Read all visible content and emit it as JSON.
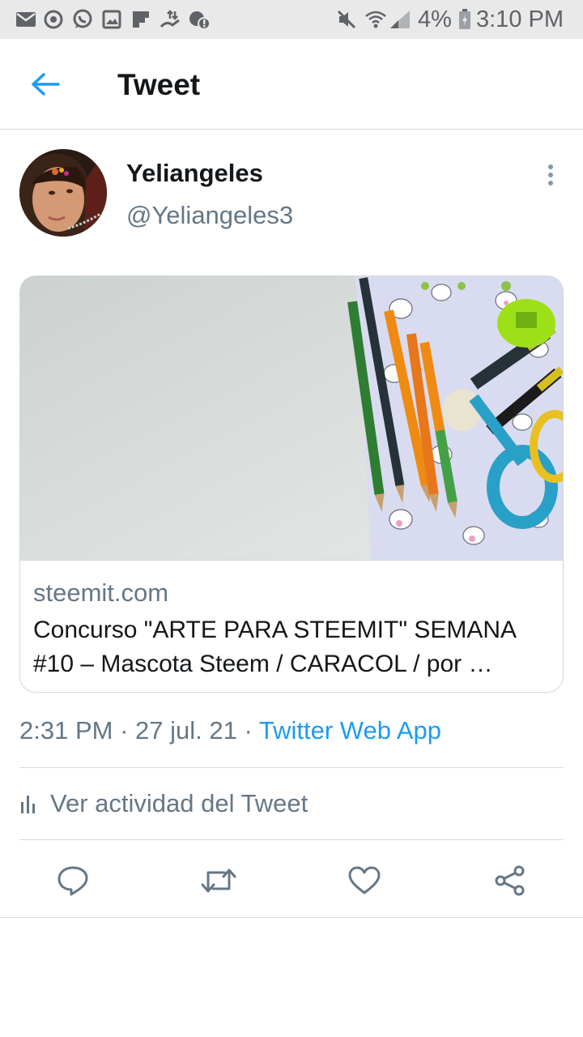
{
  "status_bar": {
    "battery_percent": "4%",
    "time": "3:10 PM",
    "left_icons": [
      "mail-icon",
      "sync-icon",
      "whatsapp-icon",
      "image-icon",
      "flipboard-icon",
      "data-transfer-icon",
      "alert-badge-icon"
    ],
    "right_icons": [
      "mute-icon",
      "wifi-icon",
      "signal-icon",
      "battery-icon"
    ]
  },
  "app_bar": {
    "title": "Tweet",
    "back_icon": "arrow-left-icon"
  },
  "author": {
    "name": "Yeliangeles",
    "handle": "@Yeliangeles3"
  },
  "link_card": {
    "domain": "steemit.com",
    "title": "Concurso \"ARTE PARA STEEMIT\" SEMANA #10 – Mascota Steem / CARACOL / por …"
  },
  "meta": {
    "time": "2:31 PM",
    "separator": "·",
    "date": "27 jul. 21",
    "source": "Twitter Web App"
  },
  "activity": {
    "label": "Ver actividad del Tweet"
  },
  "actions": [
    "reply-icon",
    "retweet-icon",
    "like-icon",
    "share-icon"
  ],
  "colors": {
    "accent": "#1d9bf0",
    "secondary_text": "#657786",
    "primary_text": "#14171a",
    "divider": "#d7dbdf"
  }
}
